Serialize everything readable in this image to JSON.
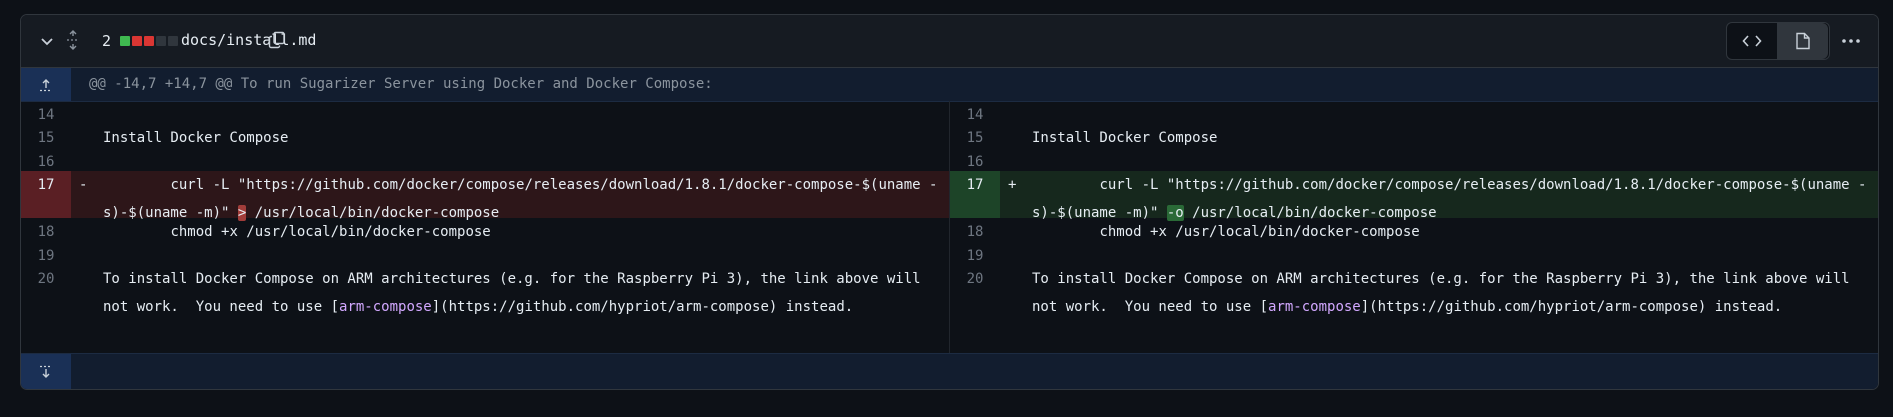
{
  "file": {
    "change_count": "2",
    "diffstat": [
      "add",
      "del",
      "del",
      "neutral",
      "neutral"
    ],
    "path": "docs/install.md",
    "colors": {
      "add": "#3fb950",
      "del": "#da3633",
      "neutral": "#30363d"
    }
  },
  "hunk": {
    "header": "@@ -14,7 +14,7 @@ To run Sugarizer Server using Docker and Docker Compose:"
  },
  "left": [
    {
      "num": "14",
      "type": "ctx",
      "marker": "",
      "text": ""
    },
    {
      "num": "15",
      "type": "ctx",
      "marker": "",
      "text": "Install Docker Compose"
    },
    {
      "num": "16",
      "type": "ctx",
      "marker": "",
      "text": ""
    },
    {
      "num": "17",
      "type": "del",
      "marker": "-",
      "pre": "        curl -L \"https://github.com/docker/compose/releases/download/1.8.1/docker-compose-$(uname -s)-$(uname -m)\" ",
      "hl": ">",
      "post": " /usr/local/bin/docker-compose"
    },
    {
      "num": "18",
      "type": "ctx",
      "marker": "",
      "text": "        chmod +x /usr/local/bin/docker-compose"
    },
    {
      "num": "19",
      "type": "ctx",
      "marker": "",
      "text": ""
    },
    {
      "num": "20",
      "type": "ctx",
      "marker": "",
      "pre": "To install Docker Compose on ARM architectures (e.g. for the Raspberry Pi 3), the link above will not work.  You need to use [",
      "link": "arm-compose",
      "post": "](https://github.com/hypriot/arm-compose) instead."
    }
  ],
  "right": [
    {
      "num": "14",
      "type": "ctx",
      "marker": "",
      "text": ""
    },
    {
      "num": "15",
      "type": "ctx",
      "marker": "",
      "text": "Install Docker Compose"
    },
    {
      "num": "16",
      "type": "ctx",
      "marker": "",
      "text": ""
    },
    {
      "num": "17",
      "type": "add",
      "marker": "+",
      "pre": "        curl -L \"https://github.com/docker/compose/releases/download/1.8.1/docker-compose-$(uname -s)-$(uname -m)\" ",
      "hl": "-o",
      "post": " /usr/local/bin/docker-compose"
    },
    {
      "num": "18",
      "type": "ctx",
      "marker": "",
      "text": "        chmod +x /usr/local/bin/docker-compose"
    },
    {
      "num": "19",
      "type": "ctx",
      "marker": "",
      "text": ""
    },
    {
      "num": "20",
      "type": "ctx",
      "marker": "",
      "pre": "To install Docker Compose on ARM architectures (e.g. for the Raspberry Pi 3), the link above will not work.  You need to use [",
      "link": "arm-compose",
      "post": "](https://github.com/hypriot/arm-compose) instead."
    }
  ]
}
